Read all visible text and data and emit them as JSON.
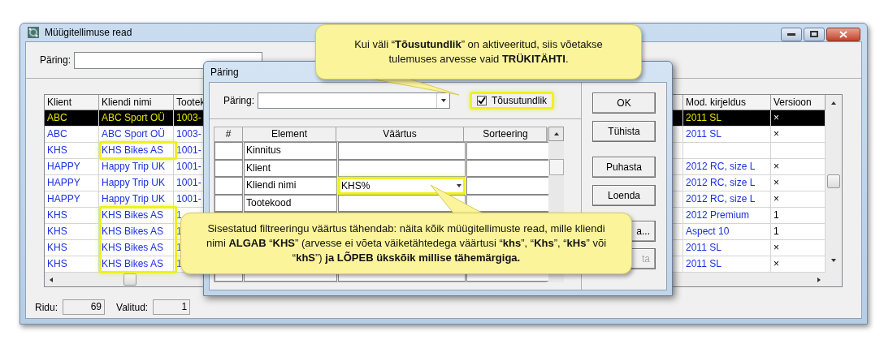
{
  "main_window": {
    "title": "Müügitellimuse read",
    "query_label": "Päring:",
    "table": {
      "columns": [
        "Klient",
        "Kliendi nimi",
        "Tootek",
        "Mod. kirjeldus",
        "Versioon"
      ],
      "rows": [
        {
          "selected": true,
          "highlighted": false,
          "cells": [
            "ABC",
            "ABC Sport OÜ",
            "1003-",
            "2011 SL",
            "×"
          ]
        },
        {
          "selected": false,
          "highlighted": false,
          "cells": [
            "ABC",
            "ABC Sport OÜ",
            "1003-",
            "2011 SL",
            "×"
          ]
        },
        {
          "selected": false,
          "highlighted": true,
          "cells": [
            "KHS",
            "KHS Bikes AS",
            "1001-",
            "",
            ""
          ]
        },
        {
          "selected": false,
          "highlighted": false,
          "cells": [
            "HAPPY",
            "Happy Trip UK",
            "1001-",
            "2012 RC, size L",
            "×"
          ]
        },
        {
          "selected": false,
          "highlighted": false,
          "cells": [
            "HAPPY",
            "Happy Trip UK",
            "1001-",
            "2012 RC, size L",
            "×"
          ]
        },
        {
          "selected": false,
          "highlighted": false,
          "cells": [
            "HAPPY",
            "Happy Trip UK",
            "1001-",
            "2012 RC, size L",
            "×"
          ]
        },
        {
          "selected": false,
          "highlighted": true,
          "cells": [
            "KHS",
            "KHS Bikes AS",
            "1",
            "2012 Premium",
            "1"
          ]
        },
        {
          "selected": false,
          "highlighted": true,
          "cells": [
            "KHS",
            "KHS Bikes AS",
            "1",
            "Aspect 10",
            "1"
          ]
        },
        {
          "selected": false,
          "highlighted": true,
          "cells": [
            "KHS",
            "KHS Bikes AS",
            "1",
            "2011 SL",
            "×"
          ]
        },
        {
          "selected": false,
          "highlighted": true,
          "cells": [
            "KHS",
            "KHS Bikes AS",
            "1",
            "2011 SL",
            "×"
          ]
        }
      ]
    },
    "status": {
      "rows_label": "Ridu:",
      "rows_value": "69",
      "selected_label": "Valitud:",
      "selected_value": "1"
    }
  },
  "dialog": {
    "title": "Päring",
    "query_label": "Päring:",
    "case_checkbox": {
      "label": "Tõusutundlik",
      "checked": true,
      "highlighted": true
    },
    "grid": {
      "columns": [
        "#",
        "Element",
        "Väärtus",
        "Sorteering"
      ],
      "rows": [
        {
          "element": "Kinnitus",
          "value": "",
          "highlighted": false
        },
        {
          "element": "Klient",
          "value": "",
          "highlighted": false
        },
        {
          "element": "Kliendi nimi",
          "value": "KHS%",
          "highlighted": true
        },
        {
          "element": "Tootekood",
          "value": "",
          "highlighted": false
        }
      ]
    },
    "buttons": [
      {
        "label": "OK",
        "disabled": false
      },
      {
        "label": "Tühista",
        "disabled": false
      },
      {
        "label": "Puhasta",
        "disabled": false
      },
      {
        "label": "Loenda",
        "disabled": false
      },
      {
        "label": "a...",
        "disabled": false
      },
      {
        "label": "ta",
        "disabled": true
      }
    ]
  },
  "callouts": [
    {
      "text": "Kui väli “**Tõusutundlik**”  on aktiveeritud, siis võetakse tulemuses arvesse vaid **TRÜKITÄHTI**."
    },
    {
      "text": "Sisestatud filtreeringu väärtus tähendab: näita kõik müügitellimuste read, mille kliendi nimi **ALGAB** “**KHS**” (arvesse ei võeta väiketähtedega väärtusi “**khs**”, “**Khs**”, “**kHs**” või “**khS**”) **ja LÕPEB ükskõik millise tähemärgiga.**"
    }
  ]
}
